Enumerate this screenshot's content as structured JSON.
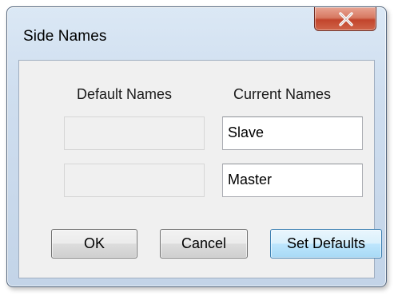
{
  "window": {
    "title": "Side Names",
    "close_icon": "close-x-icon"
  },
  "headers": {
    "default_names": "Default Names",
    "current_names": "Current Names"
  },
  "rows": [
    {
      "default_value": "",
      "current_value": "Slave"
    },
    {
      "default_value": "",
      "current_value": "Master"
    }
  ],
  "buttons": {
    "ok": "OK",
    "cancel": "Cancel",
    "set_defaults": "Set Defaults"
  }
}
